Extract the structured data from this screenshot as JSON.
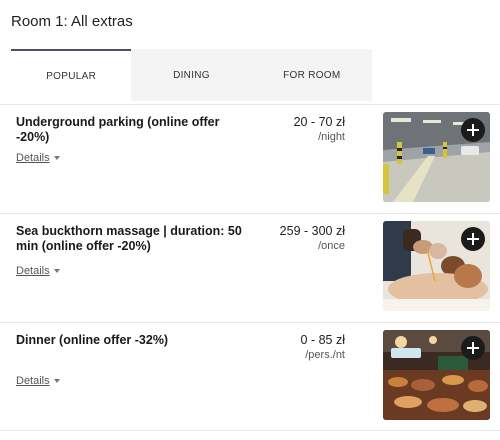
{
  "room": {
    "title": "Room 1: All extras"
  },
  "tabs": [
    {
      "label": "POPULAR",
      "active": true
    },
    {
      "label": "DINING",
      "active": false
    },
    {
      "label": "FOR ROOM",
      "active": false
    }
  ],
  "offers": [
    {
      "name": "Underground parking (online offer -20%)",
      "price": "20 - 70 zł",
      "unit": "/night",
      "details_label": "Details",
      "image": "parking-garage-photo",
      "add_icon": "plus-icon"
    },
    {
      "name": "Sea buckthorn massage | duration: 50 min (online offer -20%)",
      "price": "259 - 300 zł",
      "unit": "/once",
      "details_label": "Details",
      "image": "massage-photo",
      "add_icon": "plus-icon"
    },
    {
      "name": "Dinner (online offer -32%)",
      "price": "0 - 85 zł",
      "unit": "/pers./nt",
      "details_label": "Details",
      "image": "restaurant-buffet-photo",
      "add_icon": "plus-icon"
    }
  ],
  "colors": {
    "active_tab_border": "#4a4f6a",
    "inactive_tab_bg": "#f4f4f4",
    "add_button_bg": "#1b1b1b"
  }
}
